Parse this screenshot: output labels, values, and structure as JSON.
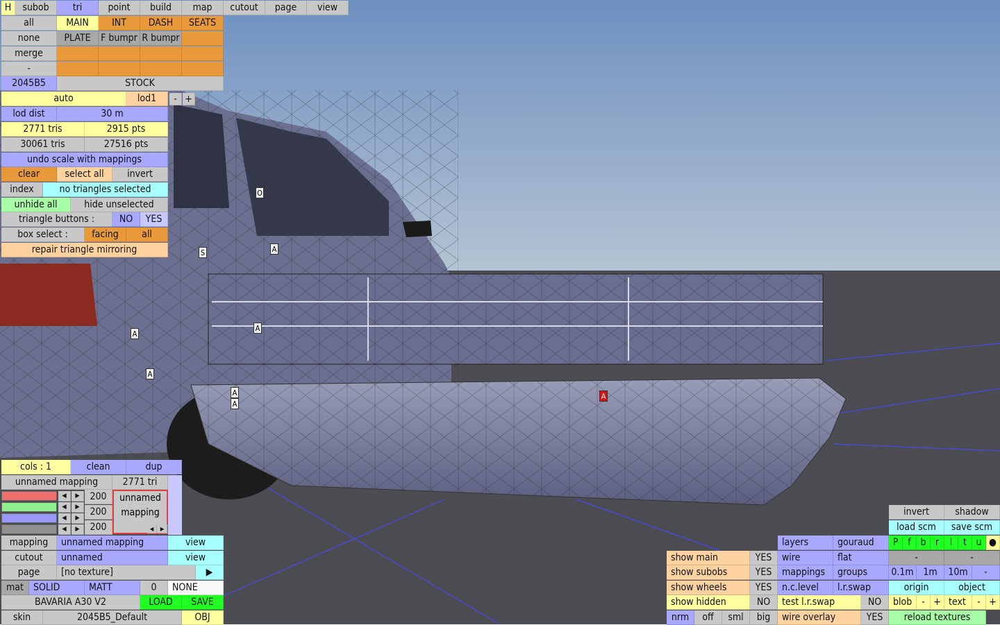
{
  "top_menu": [
    "H",
    "subob",
    "tri",
    "point",
    "build",
    "map",
    "cutout",
    "page",
    "view"
  ],
  "subob_panel": {
    "row1": [
      "all",
      "MAIN",
      "INT",
      "DASH",
      "SEATS"
    ],
    "row2": [
      "none",
      "PLATE",
      "F bumpr",
      "R bumpr",
      ""
    ],
    "row3": [
      "merge"
    ],
    "row4": [
      "-"
    ],
    "color_code": "2045B5",
    "stock": "STOCK"
  },
  "lod": {
    "auto": "auto",
    "level": "lod1",
    "minus": "-",
    "plus": "+",
    "dist_label": "lod dist",
    "dist_value": "30 m"
  },
  "stats": {
    "tris": "2771 tris",
    "pts": "2915 pts",
    "total_tris": "30061 tris",
    "total_pts": "27516 pts"
  },
  "tri_panel": {
    "undo": "undo scale with mappings",
    "clear": "clear",
    "select_all": "select all",
    "invert": "invert",
    "index": "index",
    "selection": "no triangles selected",
    "unhide_all": "unhide all",
    "hide_unselected": "hide unselected",
    "tri_buttons": "triangle buttons :",
    "no": "NO",
    "yes": "YES",
    "box_select": "box select :",
    "facing": "facing",
    "all": "all",
    "repair": "repair triangle mirroring"
  },
  "mapping_panel": {
    "cols": "cols : 1",
    "clean": "clean",
    "dup": "dup",
    "unnamed_mapping": "unnamed mapping",
    "tri_count": "2771 tri",
    "values": [
      "200",
      "200",
      "200"
    ],
    "mapping_name": [
      "unnamed",
      "mapping"
    ]
  },
  "bottom_left": {
    "mapping_label": "mapping",
    "mapping_value": "unnamed mapping",
    "view1": "view",
    "cutout_label": "cutout",
    "cutout_value": "unnamed",
    "view2": "view",
    "page_label": "page",
    "page_value": "[no texture]",
    "play": "▶",
    "mat": "mat",
    "solid": "SOLID",
    "matt": "MATT",
    "zero": "0",
    "none": "NONE",
    "car_name": "BAVARIA A30 V2",
    "load": "LOAD",
    "save": "SAVE",
    "skin": "skin",
    "skin_value": "2045B5_Default",
    "obj": "OBJ"
  },
  "bottom_right": {
    "invert": "invert",
    "shadow": "shadow",
    "load_scm": "load scm",
    "save_scm": "save scm",
    "layers": "layers",
    "gouraud": "gouraud",
    "letters": [
      "P",
      "f",
      "b",
      "r",
      "l",
      "t",
      "u",
      "●"
    ],
    "show_main": "show main",
    "show_main_v": "YES",
    "wire": "wire",
    "flat": "flat",
    "dash1": "-",
    "dash2": "-",
    "show_subobs": "show subobs",
    "show_subobs_v": "YES",
    "mappings": "mappings",
    "groups": "groups",
    "grid": [
      "0.1m",
      "1m",
      "10m",
      "-"
    ],
    "show_wheels": "show wheels",
    "show_wheels_v": "YES",
    "nclevel": "n.c.level",
    "lrswap": "l.r.swap",
    "origin": "origin",
    "object": "object",
    "show_hidden": "show hidden",
    "show_hidden_v": "NO",
    "test_lrswap": "test l.r.swap",
    "test_lrswap_v": "NO",
    "blob": "blob",
    "bminus": "-",
    "bplus": "+",
    "text": "text",
    "tminus": "-",
    "tplus": "+",
    "nrm": "nrm",
    "off": "off",
    "sml": "sml",
    "big": "big",
    "wire_overlay": "wire overlay",
    "wire_overlay_v": "YES",
    "reload": "reload textures"
  },
  "markers": [
    "O",
    "S",
    "A",
    "A",
    "A",
    "A",
    "A",
    "A",
    "A"
  ],
  "colors": {
    "sky_top": "#8ea8c6",
    "ground": "#4a4d55",
    "body": "#6b7090",
    "grid_line": "#4040e0"
  }
}
